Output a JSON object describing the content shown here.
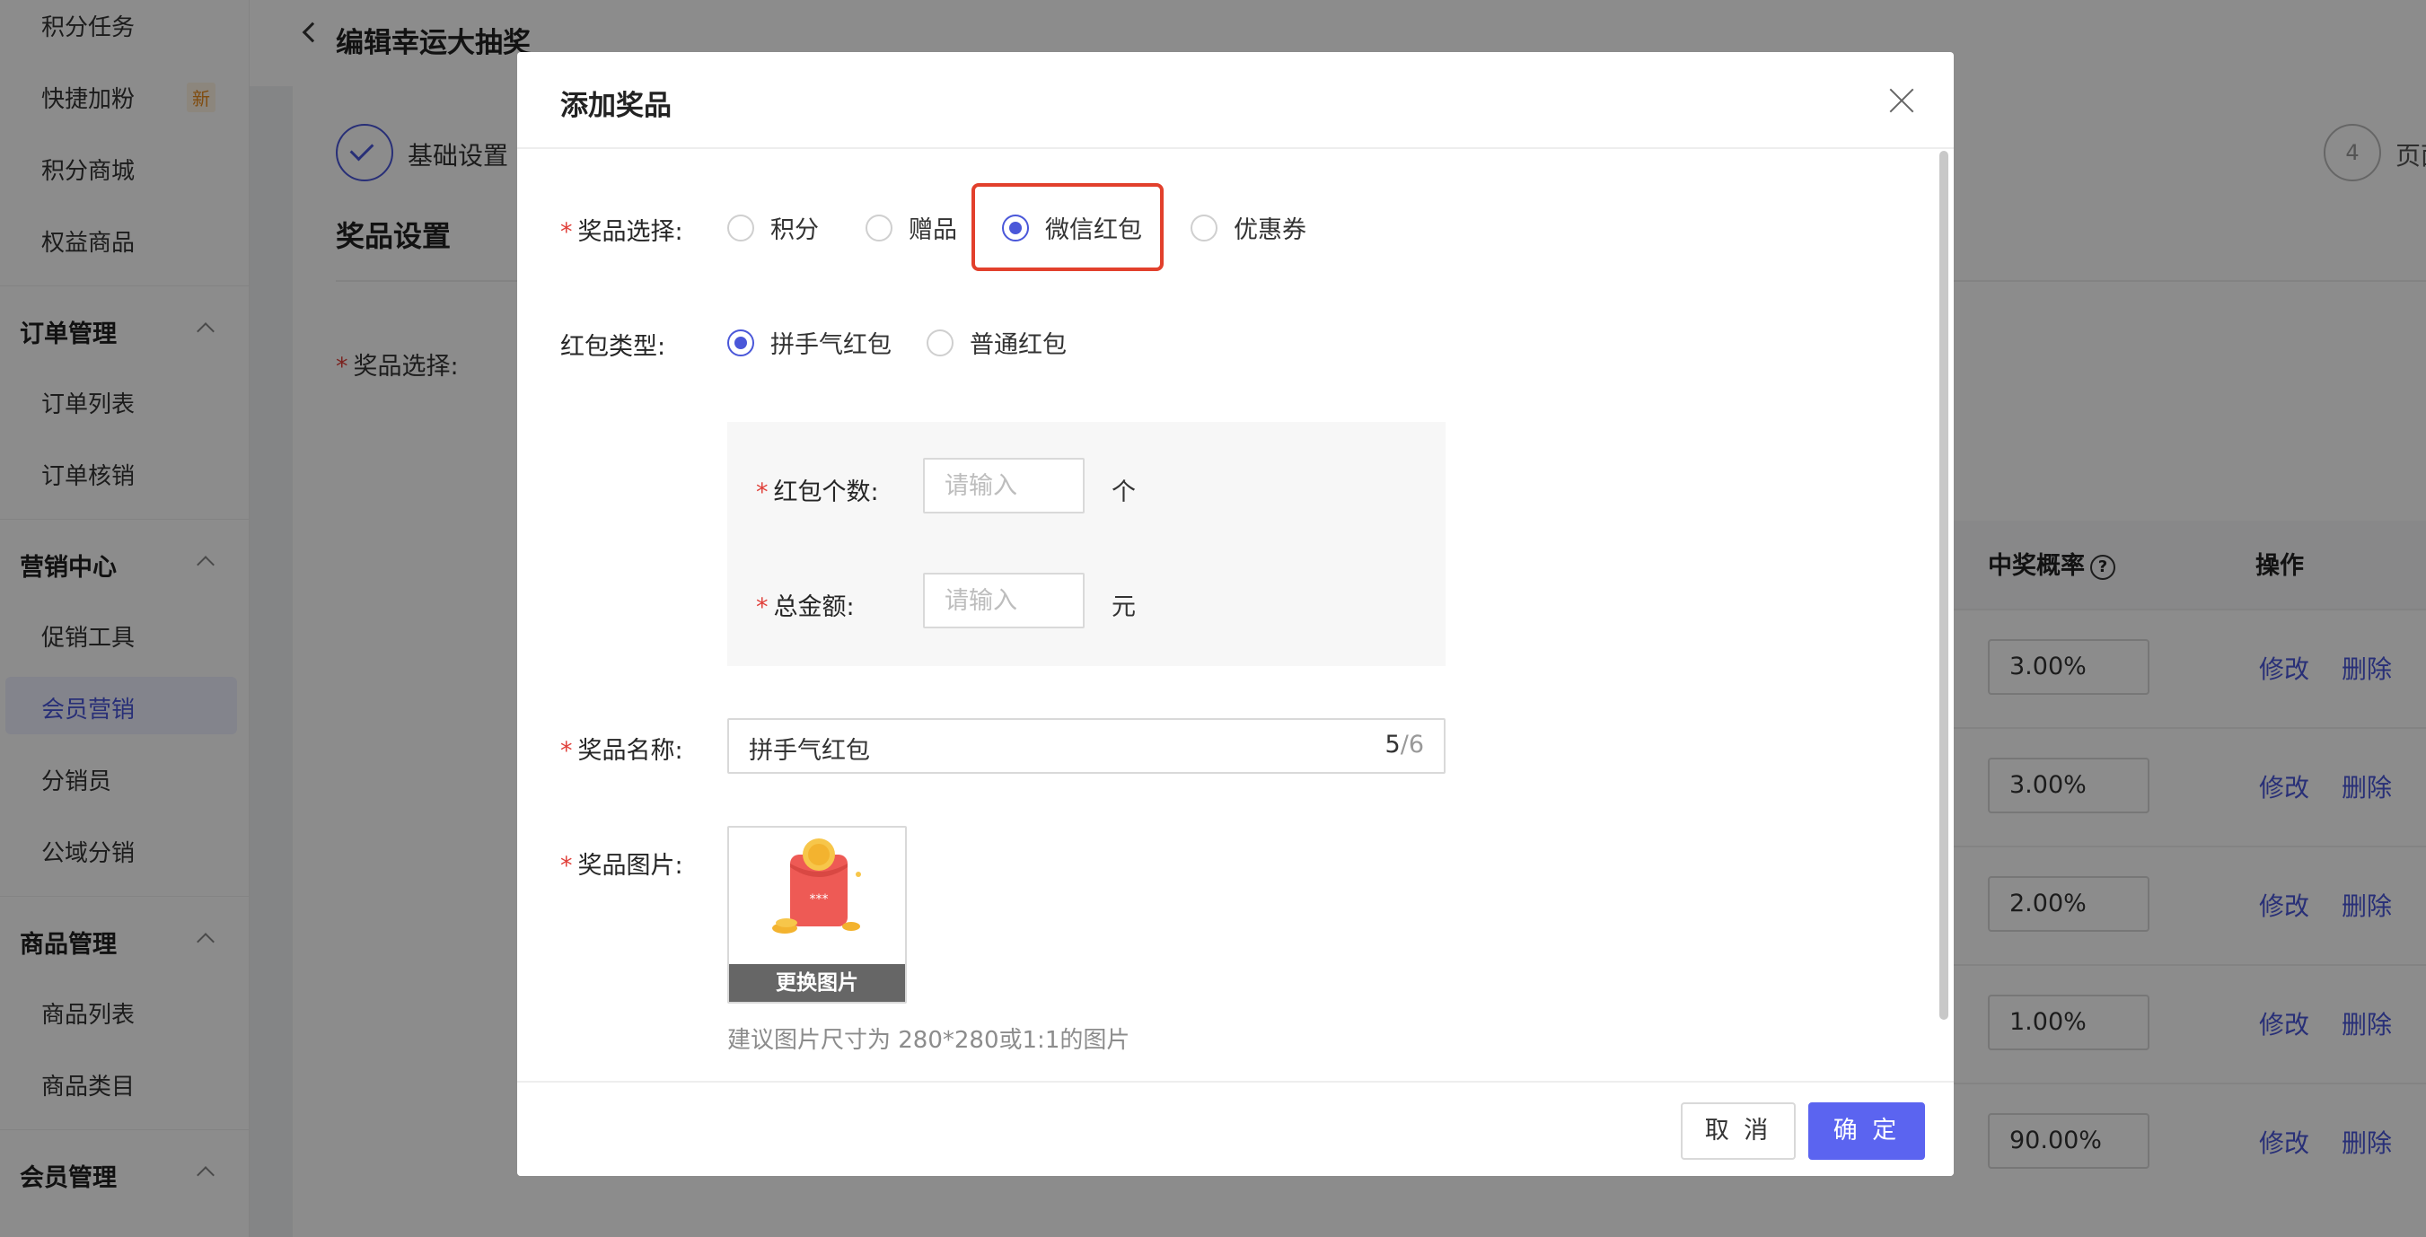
{
  "sidebar": {
    "items": [
      {
        "label": "积分任务"
      },
      {
        "label": "快捷加粉",
        "badge": "新"
      },
      {
        "label": "积分商城"
      },
      {
        "label": "权益商品"
      }
    ],
    "groups": [
      {
        "title": "订单管理",
        "items": [
          "订单列表",
          "订单核销"
        ]
      },
      {
        "title": "营销中心",
        "items": [
          "促销工具",
          "会员营销",
          "分销员",
          "公域分销"
        ]
      },
      {
        "title": "商品管理",
        "items": [
          "商品列表",
          "商品类目"
        ]
      },
      {
        "title": "会员管理",
        "items": []
      }
    ],
    "active_item": "会员营销"
  },
  "page": {
    "title": "编辑幸运大抽奖",
    "steps": [
      {
        "label": "基础设置",
        "status": "done"
      },
      {
        "number": "4",
        "label": "页面"
      }
    ],
    "section_title": "奖品设置",
    "prize_select_label": "奖品选择",
    "table": {
      "headers": {
        "probability": "中奖概率",
        "actions": "操作"
      },
      "rows": [
        {
          "probability": "3.00%",
          "edit": "修改",
          "delete": "删除"
        },
        {
          "probability": "3.00%",
          "edit": "修改",
          "delete": "删除"
        },
        {
          "probability": "2.00%",
          "edit": "修改",
          "delete": "删除"
        },
        {
          "probability": "1.00%",
          "edit": "修改",
          "delete": "删除"
        },
        {
          "probability": "90.00%",
          "edit": "修改",
          "delete": "删除"
        }
      ]
    }
  },
  "modal": {
    "title": "添加奖品",
    "prize_type": {
      "label": "奖品选择",
      "options": [
        "积分",
        "赠品",
        "微信红包",
        "优惠券"
      ],
      "selected": "微信红包"
    },
    "red_packet_type": {
      "label": "红包类型",
      "options": [
        "拼手气红包",
        "普通红包"
      ],
      "selected": "拼手气红包"
    },
    "count_field": {
      "label": "红包个数",
      "placeholder": "请输入",
      "unit": "个"
    },
    "amount_field": {
      "label": "总金额",
      "placeholder": "请输入",
      "unit": "元"
    },
    "prize_name": {
      "label": "奖品名称",
      "value": "拼手气红包",
      "count": "5",
      "max": "/6"
    },
    "prize_image": {
      "label": "奖品图片",
      "replace_label": "更换图片",
      "image_text": "***",
      "hint": "建议图片尺寸为 280*280或1:1的图片"
    },
    "buttons": {
      "cancel": "取 消",
      "ok": "确 定"
    }
  },
  "colors": {
    "primary": "#5b64f0",
    "link": "#4a57d9",
    "required": "#e0403a",
    "highlight": "#e2402c"
  }
}
